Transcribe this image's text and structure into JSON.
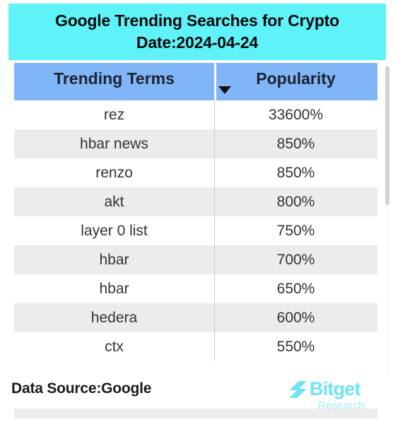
{
  "banner": {
    "title": "Google Trending Searches for Crypto",
    "date_line": "Date:2024-04-24",
    "background_color": "#5FF2F8"
  },
  "table": {
    "header_background_color": "#80B5F8",
    "row_alt_color": "#ECECEC",
    "sort_icon": "chevron-down-icon",
    "columns": [
      {
        "label": "Trending Terms"
      },
      {
        "label": "Popularity"
      }
    ],
    "rows": [
      {
        "term": "rez",
        "popularity": "33600%"
      },
      {
        "term": "hbar news",
        "popularity": "850%"
      },
      {
        "term": "renzo",
        "popularity": "850%"
      },
      {
        "term": "akt",
        "popularity": "800%"
      },
      {
        "term": "layer 0 list",
        "popularity": "750%"
      },
      {
        "term": "hbar",
        "popularity": "700%"
      },
      {
        "term": "hbar",
        "popularity": "650%"
      },
      {
        "term": "hedera",
        "popularity": "600%"
      },
      {
        "term": "ctx",
        "popularity": "550%"
      }
    ]
  },
  "footer": {
    "data_source": "Data Source:Google",
    "brand_name": "Bitget",
    "brand_sub": "Research",
    "brand_color": "#6FE3F5",
    "brand_mark": "bitget-chevron-logo-icon"
  },
  "scrollbar": {
    "orientation": "vertical"
  },
  "chart_data": {
    "type": "table",
    "title": "Google Trending Searches for Crypto Date:2024-04-24",
    "categories": [
      "rez",
      "hbar news",
      "renzo",
      "akt",
      "layer 0 list",
      "hbar",
      "hbar",
      "hedera",
      "ctx"
    ],
    "values": [
      33600,
      850,
      850,
      800,
      750,
      700,
      650,
      600,
      550
    ],
    "xlabel": "Trending Terms",
    "ylabel": "Popularity",
    "unit": "%",
    "legend": []
  }
}
